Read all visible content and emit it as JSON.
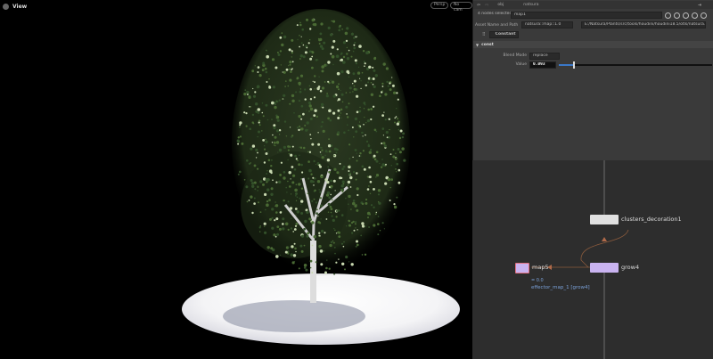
{
  "viewport": {
    "title": "View",
    "perspective": "Persp",
    "camera": "No cam"
  },
  "toolbar": {
    "path_obj": "obj",
    "path_node": "natsura"
  },
  "params": {
    "selection_label": "4 nodes selected",
    "node_name": "map1",
    "asset_label": "Asset Name and Path",
    "asset_name": "natsura::map::1.0",
    "asset_path": "E:/Natsura/Plants/src/tools/houdini/houdini18.5/otls/natsura.map...",
    "mode": "Constant",
    "section": "const",
    "blend_label": "Blend Mode",
    "blend_value": "replace",
    "value_label": "Value",
    "value": "0.093",
    "value_fraction": 0.093,
    "accent": "#3a78c8"
  },
  "network": {
    "nodes": [
      {
        "name": "clusters_decoration1",
        "color": "#e0e0e0"
      },
      {
        "name": "grow4",
        "color": "#c9b3f0"
      },
      {
        "name": "map5",
        "color": "#c9b3f0"
      }
    ],
    "map5_value": "= 0.0",
    "map5_effector": "effector_map_1 [grow4]"
  }
}
